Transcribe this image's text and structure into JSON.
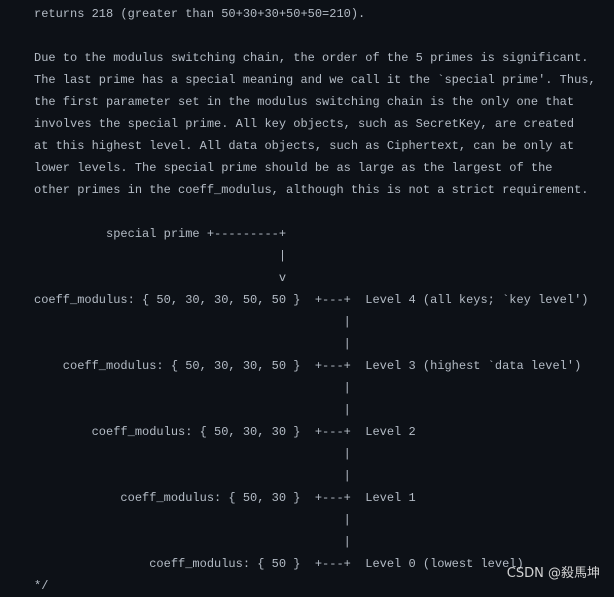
{
  "code_lines": [
    "returns 218 (greater than 50+30+30+50+50=210).",
    "",
    "Due to the modulus switching chain, the order of the 5 primes is significant.",
    "The last prime has a special meaning and we call it the `special prime'. Thus,",
    "the first parameter set in the modulus switching chain is the only one that",
    "involves the special prime. All key objects, such as SecretKey, are created",
    "at this highest level. All data objects, such as Ciphertext, can be only at",
    "lower levels. The special prime should be as large as the largest of the",
    "other primes in the coeff_modulus, although this is not a strict requirement.",
    "",
    "          special prime +---------+",
    "                                  |",
    "                                  v",
    "coeff_modulus: { 50, 30, 30, 50, 50 }  +---+  Level 4 (all keys; `key level')",
    "                                           |",
    "                                           |",
    "    coeff_modulus: { 50, 30, 30, 50 }  +---+  Level 3 (highest `data level')",
    "                                           |",
    "                                           |",
    "        coeff_modulus: { 50, 30, 30 }  +---+  Level 2",
    "                                           |",
    "                                           |",
    "            coeff_modulus: { 50, 30 }  +---+  Level 1",
    "                                           |",
    "                                           |",
    "                coeff_modulus: { 50 }  +---+  Level 0 (lowest level)",
    "*/"
  ],
  "watermark": "CSDN @殺馬坤",
  "colors": {
    "background": "#0d1117",
    "text": "#b4bcc6"
  }
}
